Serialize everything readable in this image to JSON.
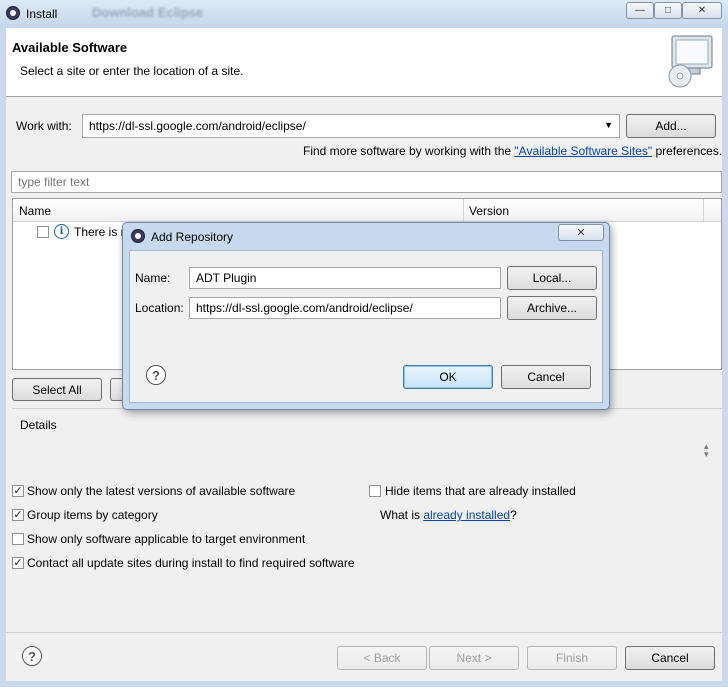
{
  "window": {
    "title": "Install",
    "ghost_title": "Download Eclipse",
    "controls": [
      "—",
      "□",
      "✕"
    ]
  },
  "header": {
    "title": "Available Software",
    "subtitle": "Select a site or enter the location of a site."
  },
  "work_with": {
    "label": "Work with:",
    "value": "https://dl-ssl.google.com/android/eclipse/",
    "add_label": "Add...",
    "find_more_prefix": "Find more software by working with the ",
    "find_more_link": "\"Available Software Sites\"",
    "find_more_suffix": " preferences."
  },
  "filter": {
    "placeholder": "type filter text"
  },
  "table": {
    "columns": [
      "Name",
      "Version"
    ],
    "rows": [
      {
        "checked": false,
        "icon": "info-icon",
        "text": "There is n"
      }
    ]
  },
  "buttons": {
    "select_all": "Select All"
  },
  "details": {
    "label": "Details"
  },
  "options": {
    "show_latest": {
      "label": "Show only the latest versions of available software",
      "checked": true
    },
    "group_by_category": {
      "label": "Group items by category",
      "checked": true
    },
    "show_applicable": {
      "label": "Show only software applicable to target environment",
      "checked": false
    },
    "contact_all": {
      "label": "Contact all update sites during install to find required software",
      "checked": true
    },
    "hide_installed": {
      "label": "Hide items that are already installed",
      "checked": false
    },
    "what_is_prefix": "What is ",
    "what_is_link": "already installed",
    "what_is_suffix": "?"
  },
  "footer": {
    "back": "< Back",
    "next": "Next >",
    "finish": "Finish",
    "cancel": "Cancel"
  },
  "dialog": {
    "title": "Add Repository",
    "close": "✕",
    "name_label": "Name:",
    "name_value": "ADT Plugin",
    "location_label": "Location:",
    "location_value": "https://dl-ssl.google.com/android/eclipse/",
    "local_button": "Local...",
    "archive_button": "Archive...",
    "ok": "OK",
    "cancel": "Cancel"
  },
  "colors": {
    "link": "#0645ad",
    "window_frame": "#c9daee",
    "dialog_frame": "#c7d9ef"
  }
}
